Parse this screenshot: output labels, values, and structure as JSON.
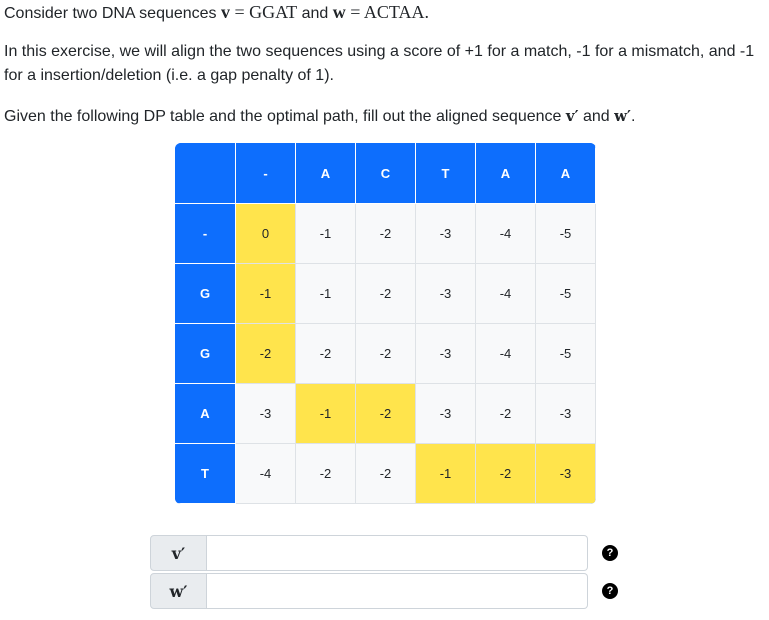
{
  "intro": {
    "prefix": "Consider two DNA sequences ",
    "v_symbol": "v",
    "v_eq": " = GGAT",
    "and": " and ",
    "w_symbol": "w",
    "w_eq": " = ACTAA."
  },
  "exercise_text": "In this exercise, we will align the two sequences using a score of +1 for a match, -1 for a mismatch, and -1 for a insertion/deletion (i.e. a gap penalty of 1).",
  "instruction": {
    "prefix": "Given the following DP table and the optimal path, fill out the aligned sequence ",
    "v_prime": "v′",
    "and": " and ",
    "w_prime": "w′",
    "suffix": "."
  },
  "dp_table": {
    "column_headers": [
      "-",
      "A",
      "C",
      "T",
      "A",
      "A"
    ],
    "row_headers": [
      "-",
      "G",
      "G",
      "A",
      "T"
    ],
    "rows": [
      [
        "0",
        "-1",
        "-2",
        "-3",
        "-4",
        "-5"
      ],
      [
        "-1",
        "-1",
        "-2",
        "-3",
        "-4",
        "-5"
      ],
      [
        "-2",
        "-2",
        "-2",
        "-3",
        "-4",
        "-5"
      ],
      [
        "-3",
        "-1",
        "-2",
        "-3",
        "-2",
        "-3"
      ],
      [
        "-4",
        "-2",
        "-2",
        "-1",
        "-2",
        "-3"
      ]
    ],
    "highlighted_path": [
      [
        0,
        0
      ],
      [
        1,
        0
      ],
      [
        2,
        0
      ],
      [
        3,
        1
      ],
      [
        3,
        2
      ],
      [
        4,
        3
      ],
      [
        4,
        4
      ],
      [
        4,
        5
      ]
    ],
    "colors": {
      "header": "#0d6efd",
      "path": "#ffe44c",
      "cell": "#f8f9fa"
    }
  },
  "answers": [
    {
      "label": "v′",
      "value": "",
      "help_icon": "question-circle"
    },
    {
      "label": "w′",
      "value": "",
      "help_icon": "question-circle"
    }
  ]
}
